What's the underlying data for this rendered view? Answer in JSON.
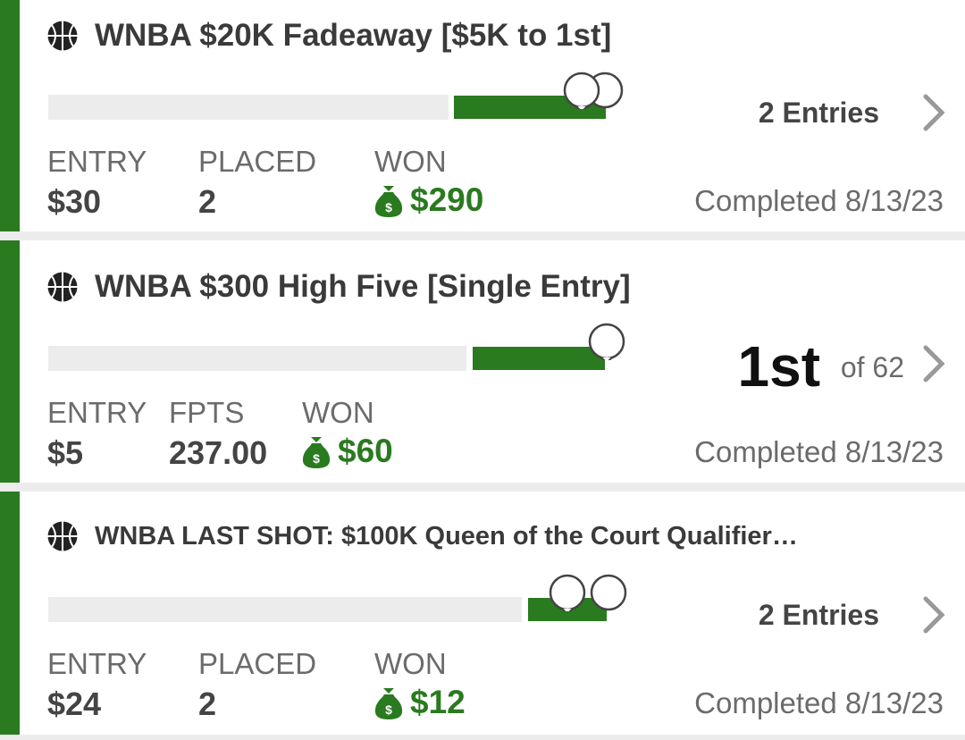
{
  "colors": {
    "accent": "#2a7a1f",
    "track": "#ececec"
  },
  "contests": [
    {
      "title": "WNBA $20K Fadeaway [$5K to 1st]",
      "progress_fraction": 0.68,
      "status": "2 Entries",
      "stat1_label": "ENTRY",
      "stat1_value": "$30",
      "stat2_label": "PLACED",
      "stat2_value": "2",
      "stat3_label": "WON",
      "stat3_value": "$290",
      "completed": "Completed 8/13/23",
      "icon": "basketball-icon"
    },
    {
      "title": "WNBA $300 High Five [Single Entry]",
      "progress_fraction": 0.72,
      "rank": "1st",
      "rank_of": "of 62",
      "stat1_label": "ENTRY",
      "stat1_value": "$5",
      "stat2_label": "FPTS",
      "stat2_value": "237.00",
      "stat3_label": "WON",
      "stat3_value": "$60",
      "completed": "Completed 8/13/23",
      "icon": "basketball-icon"
    },
    {
      "title": "WNBA LAST SHOT: $100K Queen of the Court Qualifier…",
      "progress_fraction": 0.85,
      "status": "2 Entries",
      "stat1_label": "ENTRY",
      "stat1_value": "$24",
      "stat2_label": "PLACED",
      "stat2_value": "2",
      "stat3_label": "WON",
      "stat3_value": "$12",
      "completed": "Completed 8/13/23",
      "icon": "basketball-icon"
    }
  ]
}
